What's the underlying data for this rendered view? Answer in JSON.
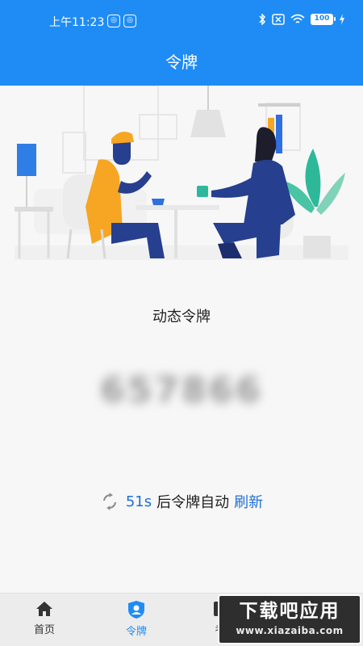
{
  "status_bar": {
    "time": "上午11:23",
    "battery": "100",
    "icons": [
      "notification-icon",
      "bluetooth-icon",
      "sim-icon",
      "wifi-icon",
      "battery-icon",
      "charging-icon"
    ]
  },
  "app_bar": {
    "title": "令牌"
  },
  "token": {
    "title": "动态令牌",
    "code": "657866"
  },
  "refresh": {
    "countdown": "51s",
    "text": "后令牌自动",
    "link": "刷新"
  },
  "tabs": [
    {
      "label": "首页",
      "icon": "home-icon"
    },
    {
      "label": "令牌",
      "icon": "shield-user-icon",
      "active": true
    },
    {
      "label": "考",
      "icon": "exam-icon"
    }
  ],
  "watermark": {
    "main": "下载吧应用",
    "sub": "www.xiazaiba.com"
  },
  "colors": {
    "primary": "#1f8cf5",
    "link": "#1f6fd6",
    "illustration_yellow": "#f6a623",
    "illustration_navy": "#263f8f"
  }
}
